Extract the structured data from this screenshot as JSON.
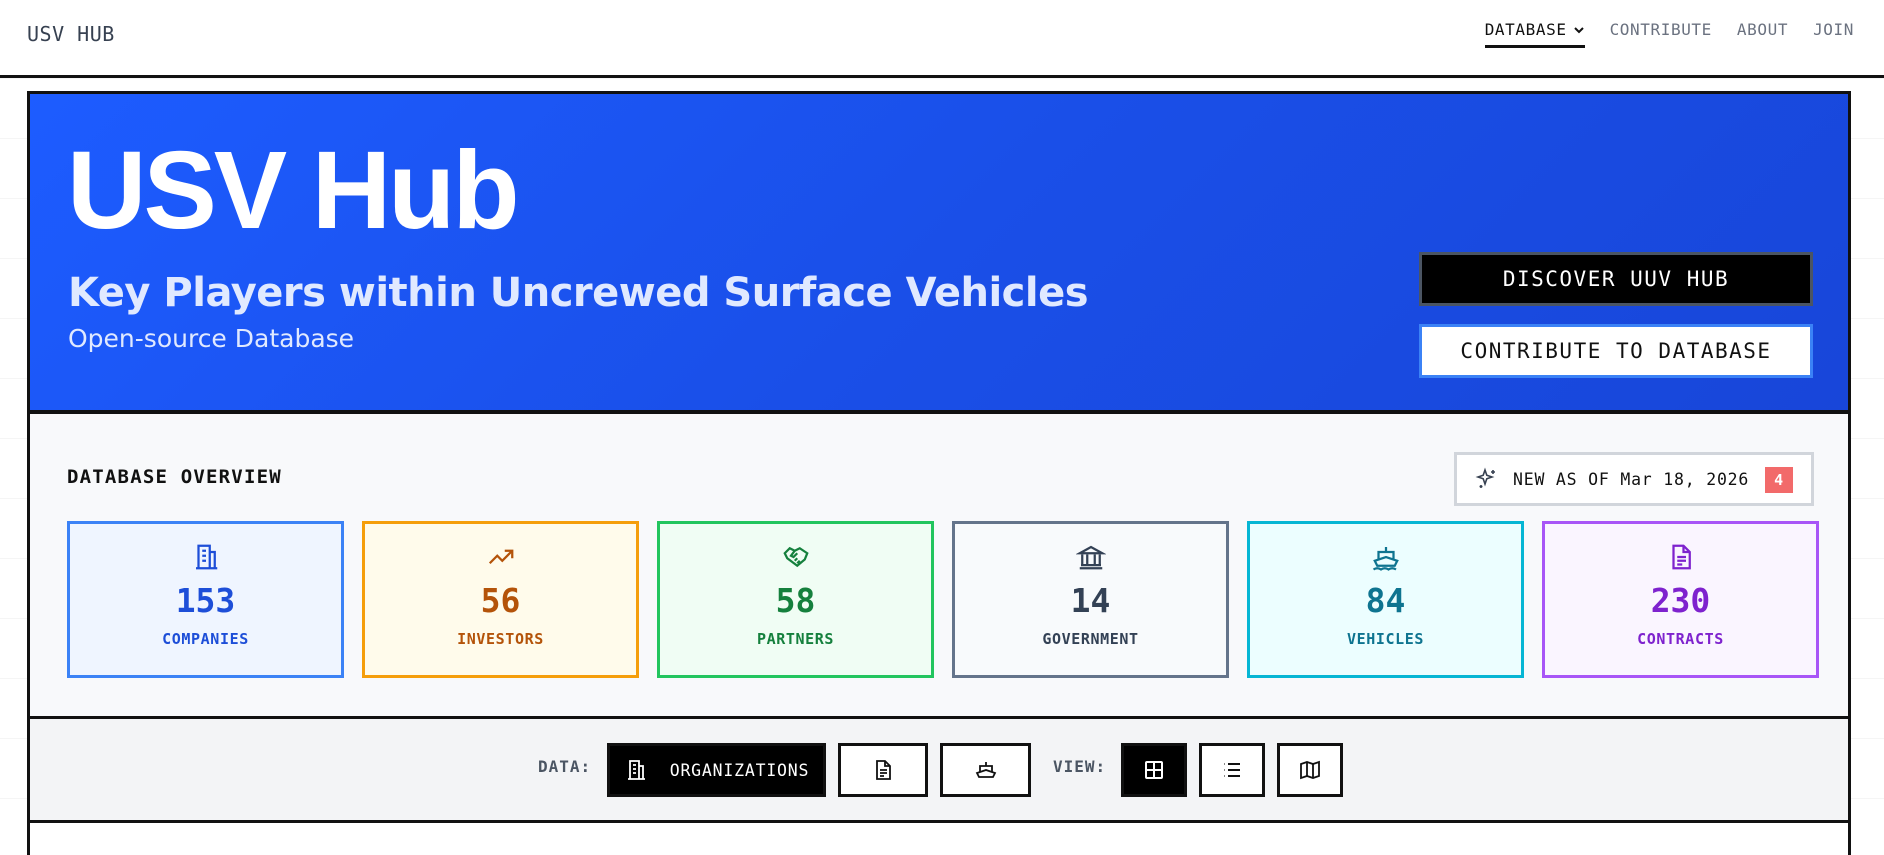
{
  "nav": {
    "brand": "USV HUB",
    "links": [
      {
        "label": "DATABASE",
        "active": true
      },
      {
        "label": "CONTRIBUTE"
      },
      {
        "label": "ABOUT"
      },
      {
        "label": "JOIN"
      }
    ]
  },
  "hero": {
    "title": "USV Hub",
    "subtitle": "Key Players within Uncrewed Surface Vehicles",
    "tagline": "Open-source Database",
    "primary_button": "DISCOVER UUV HUB",
    "secondary_button": "CONTRIBUTE TO DATABASE"
  },
  "overview": {
    "title": "DATABASE OVERVIEW",
    "new_label": "NEW AS OF Mar 18, 2026",
    "new_count": "4",
    "stats": [
      {
        "value": "153",
        "label": "COMPANIES",
        "icon": "building-icon",
        "color": "#1d4ed8",
        "border": "#3b82f6",
        "bg": "#eff5ff"
      },
      {
        "value": "56",
        "label": "INVESTORS",
        "icon": "trending-up-icon",
        "color": "#b45309",
        "border": "#f59e0b",
        "bg": "#fffbeb"
      },
      {
        "value": "58",
        "label": "PARTNERS",
        "icon": "handshake-icon",
        "color": "#15803d",
        "border": "#22c55e",
        "bg": "#f0fdf4"
      },
      {
        "value": "14",
        "label": "GOVERNMENT",
        "icon": "government-icon",
        "color": "#334155",
        "border": "#64748b",
        "bg": "#f8fafc"
      },
      {
        "value": "84",
        "label": "VEHICLES",
        "icon": "ship-icon",
        "color": "#0e7490",
        "border": "#06b6d4",
        "bg": "#ecfeff"
      },
      {
        "value": "230",
        "label": "CONTRACTS",
        "icon": "document-icon",
        "color": "#7e22ce",
        "border": "#a855f7",
        "bg": "#faf5ff"
      }
    ]
  },
  "controls": {
    "data_label": "DATA:",
    "organizations_label": "ORGANIZATIONS",
    "view_label": "VIEW:"
  }
}
